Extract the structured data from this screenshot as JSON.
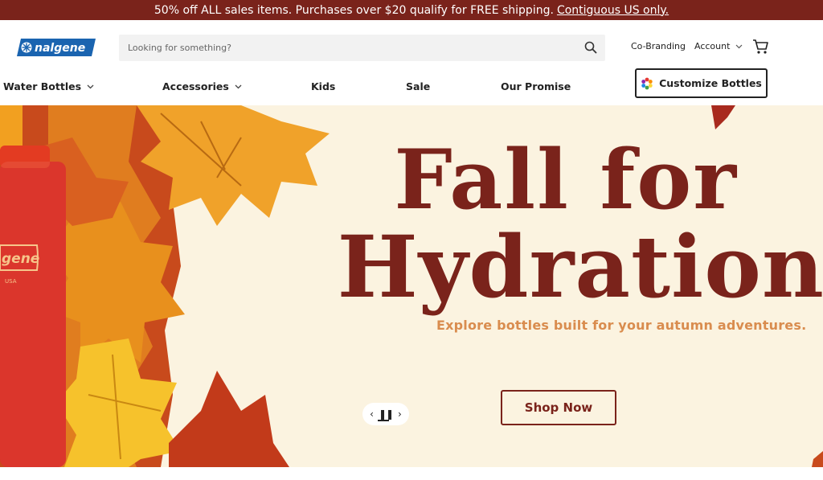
{
  "promo": {
    "text": "50% off ALL sales items. Purchases over $20 qualify for FREE shipping.",
    "link": "Contiguous US only."
  },
  "header": {
    "logo_text": "nalgene",
    "search_placeholder": "Looking for something?",
    "cobranding": "Co-Branding",
    "account": "Account"
  },
  "nav": {
    "items": [
      {
        "label": "Water Bottles",
        "has_dropdown": true
      },
      {
        "label": "Accessories",
        "has_dropdown": true
      },
      {
        "label": "Kids",
        "has_dropdown": false
      },
      {
        "label": "Sale",
        "has_dropdown": false
      },
      {
        "label": "Our Promise",
        "has_dropdown": false
      }
    ],
    "customize_label": "Customize Bottles"
  },
  "hero": {
    "line1": "Fall for",
    "line2": "Hydration",
    "subhead": "Explore bottles built for your autumn adventures.",
    "cta": "Shop Now",
    "bottle_logo": "gene",
    "bottle_small_text": "USA"
  },
  "colors": {
    "brand_maroon": "#7a231b",
    "hero_bg": "#fbf3e0",
    "subhead_orange": "#d98c4e",
    "logo_blue": "#1a64b0"
  }
}
